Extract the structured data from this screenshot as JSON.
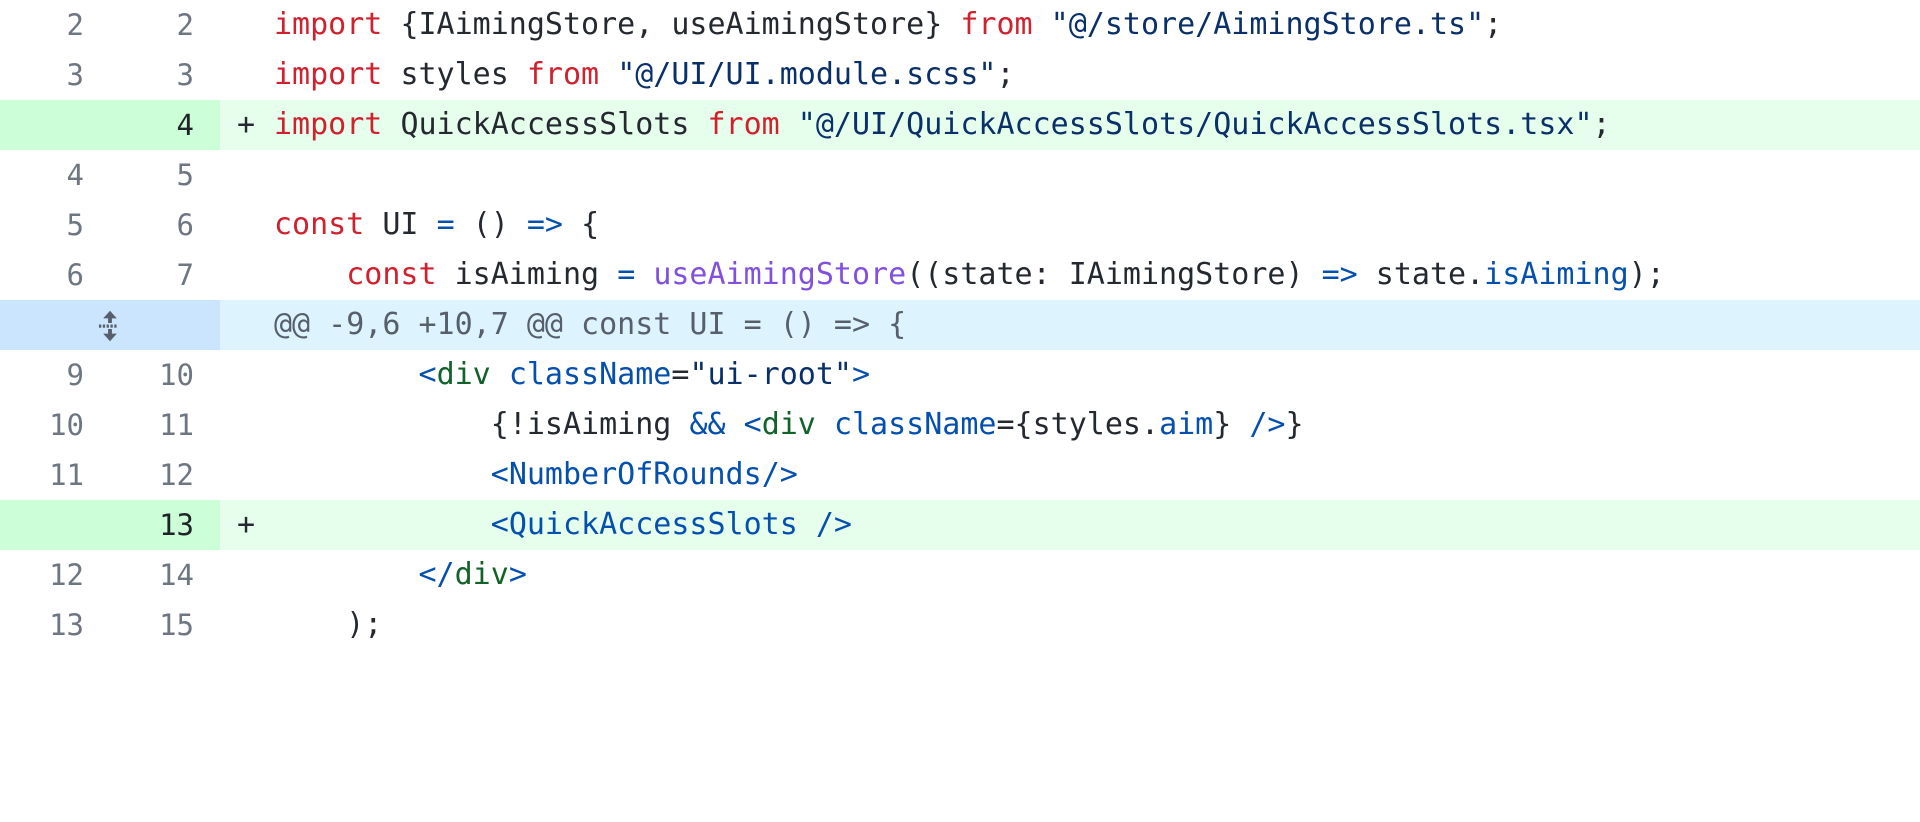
{
  "view": {
    "type": "unified-diff",
    "colors": {
      "add_gutter_bg": "#ccffd8",
      "add_code_bg": "#e6ffec",
      "hunk_gutter_bg": "#cce5ff",
      "hunk_code_bg": "#ddf4ff",
      "context_bg": "#ffffff",
      "line_number_fg": "#6e7781",
      "keyword": "#cf222e",
      "string": "#0a3069",
      "function": "#8250df",
      "operator": "#0550ae",
      "jsx_tag": "#116329",
      "plain": "#24292f",
      "hunk_text": "#57606a"
    },
    "markers": {
      "added": "+",
      "removed": "-",
      "context": ""
    }
  },
  "rows": [
    {
      "kind": "context",
      "old_line": "2",
      "new_line": "2",
      "marker": "",
      "tokens": [
        {
          "t": "import ",
          "c": "kw"
        },
        {
          "t": "{IAimingStore, useAimingStore} ",
          "c": "plain"
        },
        {
          "t": "from ",
          "c": "kw"
        },
        {
          "t": "\"@/store/AimingStore.ts\"",
          "c": "str"
        },
        {
          "t": ";",
          "c": "plain"
        }
      ],
      "plain_text": "import {IAimingStore, useAimingStore} from \"@/store/AimingStore.ts\";"
    },
    {
      "kind": "context",
      "old_line": "3",
      "new_line": "3",
      "marker": "",
      "tokens": [
        {
          "t": "import ",
          "c": "kw"
        },
        {
          "t": "styles ",
          "c": "plain"
        },
        {
          "t": "from ",
          "c": "kw"
        },
        {
          "t": "\"@/UI/UI.module.scss\"",
          "c": "str"
        },
        {
          "t": ";",
          "c": "plain"
        }
      ],
      "plain_text": "import styles from \"@/UI/UI.module.scss\";"
    },
    {
      "kind": "add",
      "old_line": "",
      "new_line": "4",
      "marker": "+",
      "tokens": [
        {
          "t": "import ",
          "c": "kw"
        },
        {
          "t": "QuickAccessSlots ",
          "c": "plain"
        },
        {
          "t": "from ",
          "c": "kw"
        },
        {
          "t": "\"@/UI/QuickAccessSlots/QuickAccessSlots.tsx\"",
          "c": "str"
        },
        {
          "t": ";",
          "c": "plain"
        }
      ],
      "plain_text": "import QuickAccessSlots from \"@/UI/QuickAccessSlots/QuickAccessSlots.tsx\";"
    },
    {
      "kind": "context",
      "old_line": "4",
      "new_line": "5",
      "marker": "",
      "tokens": [],
      "plain_text": ""
    },
    {
      "kind": "context",
      "old_line": "5",
      "new_line": "6",
      "marker": "",
      "tokens": [
        {
          "t": "const ",
          "c": "kw"
        },
        {
          "t": "UI ",
          "c": "plain"
        },
        {
          "t": "= ",
          "c": "op"
        },
        {
          "t": "() ",
          "c": "plain"
        },
        {
          "t": "=> ",
          "c": "op"
        },
        {
          "t": "{",
          "c": "plain"
        }
      ],
      "plain_text": "const UI = () => {"
    },
    {
      "kind": "context",
      "old_line": "6",
      "new_line": "7",
      "marker": "",
      "tokens": [
        {
          "t": "    ",
          "c": "plain"
        },
        {
          "t": "const ",
          "c": "kw"
        },
        {
          "t": "isAiming ",
          "c": "plain"
        },
        {
          "t": "= ",
          "c": "op"
        },
        {
          "t": "useAimingStore",
          "c": "fn"
        },
        {
          "t": "((state: IAimingStore) ",
          "c": "plain"
        },
        {
          "t": "=> ",
          "c": "op"
        },
        {
          "t": "state.",
          "c": "plain"
        },
        {
          "t": "isAiming",
          "c": "attr"
        },
        {
          "t": ");",
          "c": "plain"
        }
      ],
      "plain_text": "    const isAiming = useAimingStore((state: IAimingStore) => state.isAiming);"
    },
    {
      "kind": "hunk",
      "old_line": "",
      "new_line": "",
      "marker": "",
      "expander_icon": "expand-up-down-icon",
      "tokens": [
        {
          "t": "@@ -9,6 +10,7 @@ const UI = () => {",
          "c": "cmt"
        }
      ],
      "plain_text": "@@ -9,6 +10,7 @@ const UI = () => {"
    },
    {
      "kind": "context",
      "old_line": "9",
      "new_line": "10",
      "marker": "",
      "tokens": [
        {
          "t": "        ",
          "c": "plain"
        },
        {
          "t": "<",
          "c": "punct"
        },
        {
          "t": "div ",
          "c": "tag"
        },
        {
          "t": "className",
          "c": "attr"
        },
        {
          "t": "=",
          "c": "plain"
        },
        {
          "t": "\"ui-root\"",
          "c": "str"
        },
        {
          "t": ">",
          "c": "punct"
        }
      ],
      "plain_text": "        <div className=\"ui-root\">"
    },
    {
      "kind": "context",
      "old_line": "10",
      "new_line": "11",
      "marker": "",
      "tokens": [
        {
          "t": "            ",
          "c": "plain"
        },
        {
          "t": "{!isAiming ",
          "c": "plain"
        },
        {
          "t": "&& ",
          "c": "op"
        },
        {
          "t": "<",
          "c": "punct"
        },
        {
          "t": "div ",
          "c": "tag"
        },
        {
          "t": "className",
          "c": "attr"
        },
        {
          "t": "={styles.",
          "c": "plain"
        },
        {
          "t": "aim",
          "c": "attr"
        },
        {
          "t": "} ",
          "c": "plain"
        },
        {
          "t": "/>",
          "c": "punct"
        },
        {
          "t": "}",
          "c": "plain"
        }
      ],
      "plain_text": "            {!isAiming && <div className={styles.aim} />}"
    },
    {
      "kind": "context",
      "old_line": "11",
      "new_line": "12",
      "marker": "",
      "tokens": [
        {
          "t": "            ",
          "c": "plain"
        },
        {
          "t": "<",
          "c": "punct"
        },
        {
          "t": "NumberOfRounds",
          "c": "attr"
        },
        {
          "t": "/>",
          "c": "punct"
        }
      ],
      "plain_text": "            <NumberOfRounds/>"
    },
    {
      "kind": "add",
      "old_line": "",
      "new_line": "13",
      "marker": "+",
      "tokens": [
        {
          "t": "            ",
          "c": "plain"
        },
        {
          "t": "<",
          "c": "punct"
        },
        {
          "t": "QuickAccessSlots ",
          "c": "attr"
        },
        {
          "t": "/>",
          "c": "punct"
        }
      ],
      "plain_text": "            <QuickAccessSlots />"
    },
    {
      "kind": "context",
      "old_line": "12",
      "new_line": "14",
      "marker": "",
      "tokens": [
        {
          "t": "        ",
          "c": "plain"
        },
        {
          "t": "</",
          "c": "punct"
        },
        {
          "t": "div",
          "c": "tag"
        },
        {
          "t": ">",
          "c": "punct"
        }
      ],
      "plain_text": "        </div>"
    },
    {
      "kind": "context",
      "old_line": "13",
      "new_line": "15",
      "marker": "",
      "tokens": [
        {
          "t": "    );",
          "c": "plain"
        }
      ],
      "plain_text": "    );"
    }
  ]
}
